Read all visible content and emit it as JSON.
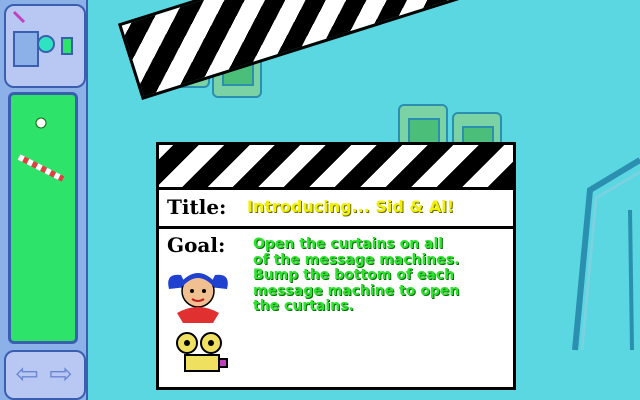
{
  "navigation": {
    "back_arrow": "⇦",
    "forward_arrow": "⇨"
  },
  "card": {
    "title_label": "Title:",
    "title": "Introducing... Sid & Al!",
    "goal_label": "Goal:",
    "goal_lines": [
      "Open the curtains on all",
      "of the message machines.",
      "Bump the bottom of each",
      "message machine to open",
      "the curtains."
    ]
  },
  "colors": {
    "background": "#5ad7e0",
    "goal_text": "#2ee32e",
    "title_text": "#f0f000",
    "panel": "#8cb0e8"
  }
}
